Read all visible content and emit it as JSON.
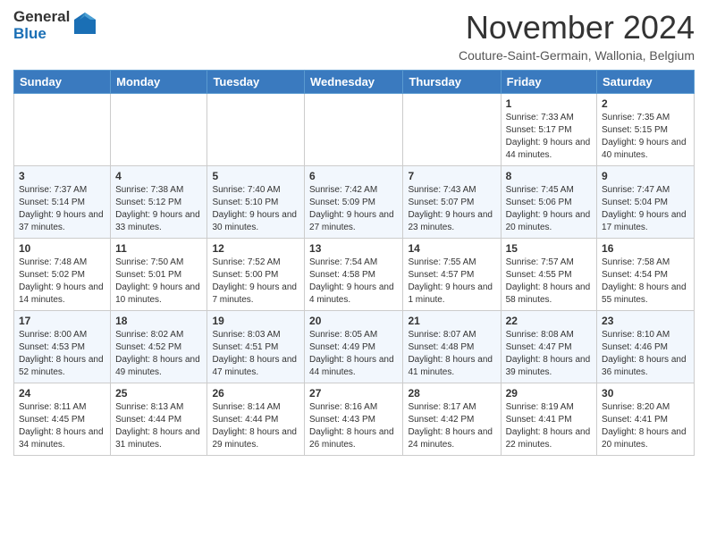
{
  "logo": {
    "general": "General",
    "blue": "Blue"
  },
  "header": {
    "month": "November 2024",
    "location": "Couture-Saint-Germain, Wallonia, Belgium"
  },
  "weekdays": [
    "Sunday",
    "Monday",
    "Tuesday",
    "Wednesday",
    "Thursday",
    "Friday",
    "Saturday"
  ],
  "weeks": [
    [
      {
        "day": "",
        "sunrise": "",
        "sunset": "",
        "daylight": ""
      },
      {
        "day": "",
        "sunrise": "",
        "sunset": "",
        "daylight": ""
      },
      {
        "day": "",
        "sunrise": "",
        "sunset": "",
        "daylight": ""
      },
      {
        "day": "",
        "sunrise": "",
        "sunset": "",
        "daylight": ""
      },
      {
        "day": "",
        "sunrise": "",
        "sunset": "",
        "daylight": ""
      },
      {
        "day": "1",
        "sunrise": "Sunrise: 7:33 AM",
        "sunset": "Sunset: 5:17 PM",
        "daylight": "Daylight: 9 hours and 44 minutes."
      },
      {
        "day": "2",
        "sunrise": "Sunrise: 7:35 AM",
        "sunset": "Sunset: 5:15 PM",
        "daylight": "Daylight: 9 hours and 40 minutes."
      }
    ],
    [
      {
        "day": "3",
        "sunrise": "Sunrise: 7:37 AM",
        "sunset": "Sunset: 5:14 PM",
        "daylight": "Daylight: 9 hours and 37 minutes."
      },
      {
        "day": "4",
        "sunrise": "Sunrise: 7:38 AM",
        "sunset": "Sunset: 5:12 PM",
        "daylight": "Daylight: 9 hours and 33 minutes."
      },
      {
        "day": "5",
        "sunrise": "Sunrise: 7:40 AM",
        "sunset": "Sunset: 5:10 PM",
        "daylight": "Daylight: 9 hours and 30 minutes."
      },
      {
        "day": "6",
        "sunrise": "Sunrise: 7:42 AM",
        "sunset": "Sunset: 5:09 PM",
        "daylight": "Daylight: 9 hours and 27 minutes."
      },
      {
        "day": "7",
        "sunrise": "Sunrise: 7:43 AM",
        "sunset": "Sunset: 5:07 PM",
        "daylight": "Daylight: 9 hours and 23 minutes."
      },
      {
        "day": "8",
        "sunrise": "Sunrise: 7:45 AM",
        "sunset": "Sunset: 5:06 PM",
        "daylight": "Daylight: 9 hours and 20 minutes."
      },
      {
        "day": "9",
        "sunrise": "Sunrise: 7:47 AM",
        "sunset": "Sunset: 5:04 PM",
        "daylight": "Daylight: 9 hours and 17 minutes."
      }
    ],
    [
      {
        "day": "10",
        "sunrise": "Sunrise: 7:48 AM",
        "sunset": "Sunset: 5:02 PM",
        "daylight": "Daylight: 9 hours and 14 minutes."
      },
      {
        "day": "11",
        "sunrise": "Sunrise: 7:50 AM",
        "sunset": "Sunset: 5:01 PM",
        "daylight": "Daylight: 9 hours and 10 minutes."
      },
      {
        "day": "12",
        "sunrise": "Sunrise: 7:52 AM",
        "sunset": "Sunset: 5:00 PM",
        "daylight": "Daylight: 9 hours and 7 minutes."
      },
      {
        "day": "13",
        "sunrise": "Sunrise: 7:54 AM",
        "sunset": "Sunset: 4:58 PM",
        "daylight": "Daylight: 9 hours and 4 minutes."
      },
      {
        "day": "14",
        "sunrise": "Sunrise: 7:55 AM",
        "sunset": "Sunset: 4:57 PM",
        "daylight": "Daylight: 9 hours and 1 minute."
      },
      {
        "day": "15",
        "sunrise": "Sunrise: 7:57 AM",
        "sunset": "Sunset: 4:55 PM",
        "daylight": "Daylight: 8 hours and 58 minutes."
      },
      {
        "day": "16",
        "sunrise": "Sunrise: 7:58 AM",
        "sunset": "Sunset: 4:54 PM",
        "daylight": "Daylight: 8 hours and 55 minutes."
      }
    ],
    [
      {
        "day": "17",
        "sunrise": "Sunrise: 8:00 AM",
        "sunset": "Sunset: 4:53 PM",
        "daylight": "Daylight: 8 hours and 52 minutes."
      },
      {
        "day": "18",
        "sunrise": "Sunrise: 8:02 AM",
        "sunset": "Sunset: 4:52 PM",
        "daylight": "Daylight: 8 hours and 49 minutes."
      },
      {
        "day": "19",
        "sunrise": "Sunrise: 8:03 AM",
        "sunset": "Sunset: 4:51 PM",
        "daylight": "Daylight: 8 hours and 47 minutes."
      },
      {
        "day": "20",
        "sunrise": "Sunrise: 8:05 AM",
        "sunset": "Sunset: 4:49 PM",
        "daylight": "Daylight: 8 hours and 44 minutes."
      },
      {
        "day": "21",
        "sunrise": "Sunrise: 8:07 AM",
        "sunset": "Sunset: 4:48 PM",
        "daylight": "Daylight: 8 hours and 41 minutes."
      },
      {
        "day": "22",
        "sunrise": "Sunrise: 8:08 AM",
        "sunset": "Sunset: 4:47 PM",
        "daylight": "Daylight: 8 hours and 39 minutes."
      },
      {
        "day": "23",
        "sunrise": "Sunrise: 8:10 AM",
        "sunset": "Sunset: 4:46 PM",
        "daylight": "Daylight: 8 hours and 36 minutes."
      }
    ],
    [
      {
        "day": "24",
        "sunrise": "Sunrise: 8:11 AM",
        "sunset": "Sunset: 4:45 PM",
        "daylight": "Daylight: 8 hours and 34 minutes."
      },
      {
        "day": "25",
        "sunrise": "Sunrise: 8:13 AM",
        "sunset": "Sunset: 4:44 PM",
        "daylight": "Daylight: 8 hours and 31 minutes."
      },
      {
        "day": "26",
        "sunrise": "Sunrise: 8:14 AM",
        "sunset": "Sunset: 4:44 PM",
        "daylight": "Daylight: 8 hours and 29 minutes."
      },
      {
        "day": "27",
        "sunrise": "Sunrise: 8:16 AM",
        "sunset": "Sunset: 4:43 PM",
        "daylight": "Daylight: 8 hours and 26 minutes."
      },
      {
        "day": "28",
        "sunrise": "Sunrise: 8:17 AM",
        "sunset": "Sunset: 4:42 PM",
        "daylight": "Daylight: 8 hours and 24 minutes."
      },
      {
        "day": "29",
        "sunrise": "Sunrise: 8:19 AM",
        "sunset": "Sunset: 4:41 PM",
        "daylight": "Daylight: 8 hours and 22 minutes."
      },
      {
        "day": "30",
        "sunrise": "Sunrise: 8:20 AM",
        "sunset": "Sunset: 4:41 PM",
        "daylight": "Daylight: 8 hours and 20 minutes."
      }
    ]
  ]
}
